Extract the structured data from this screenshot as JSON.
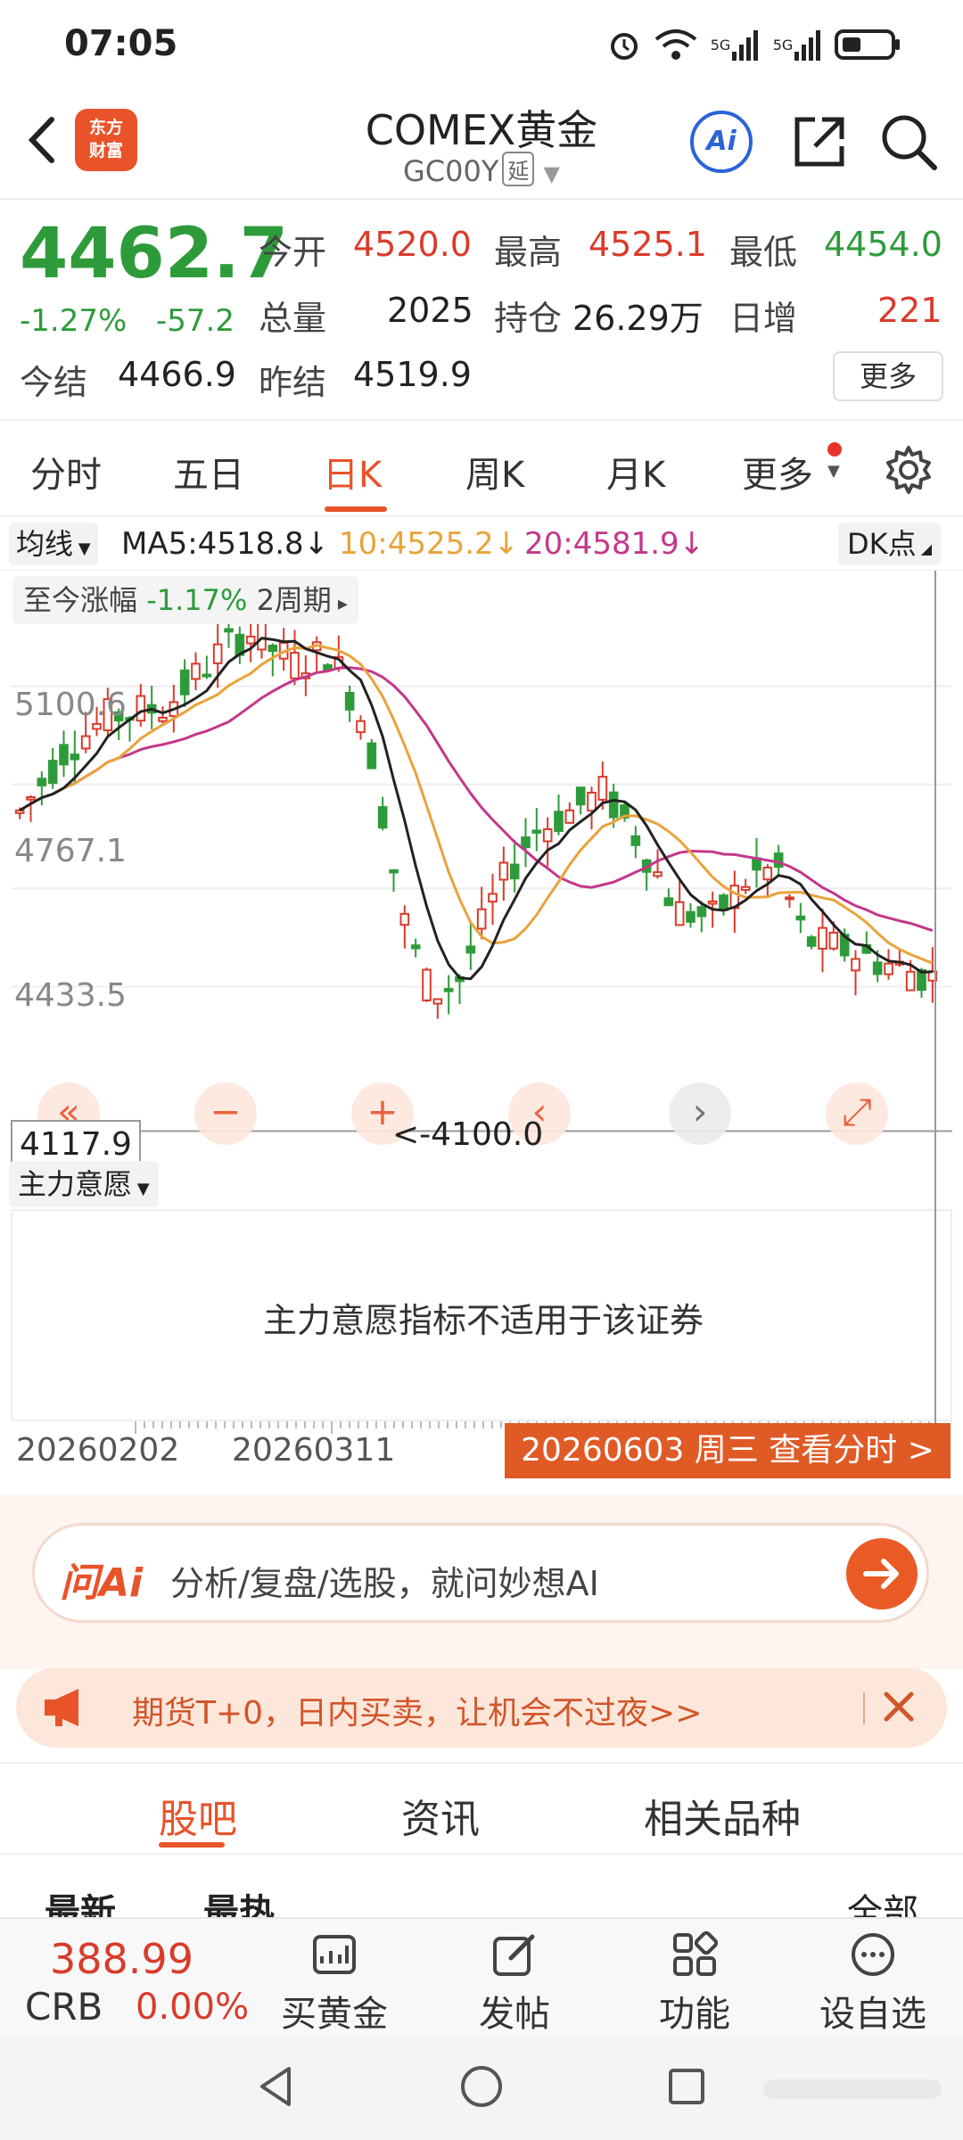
{
  "status_bar": {
    "time": "07:05",
    "network1": "5G",
    "network2": "5G"
  },
  "header": {
    "logo_line1": "东方",
    "logo_line2": "财富",
    "title": "COMEX黄金",
    "subtitle": "GC00Y",
    "delay_tag": "延",
    "ai_label": "Ai"
  },
  "quote": {
    "last": "4462.7",
    "change_pct": "-1.27%",
    "change_abs": "-57.2",
    "open_label": "今开",
    "open": "4520.0",
    "high_label": "最高",
    "high": "4525.1",
    "low_label": "最低",
    "low": "4454.0",
    "volume_label": "总量",
    "volume": "2025",
    "oi_label": "持仓",
    "oi": "26.29万",
    "daily_add_label": "日增",
    "daily_add": "221",
    "settle_label": "今结",
    "settle": "4466.9",
    "prev_settle_label": "昨结",
    "prev_settle": "4519.9",
    "more_label": "更多"
  },
  "period_tabs": [
    "分时",
    "五日",
    "日K",
    "周K",
    "月K",
    "更多"
  ],
  "ma": {
    "select_label": "均线",
    "ma5": "MA5:4518.8↓",
    "ma10": "10:4525.2↓",
    "ma20": "20:4581.9↓",
    "dk_label": "DK点",
    "colors": {
      "ma5": "#222222",
      "ma10": "#e9a33a",
      "ma20": "#c4378a",
      "up": "#d93b2b",
      "down": "#2e9b3a"
    }
  },
  "chart": {
    "period_change_label": "至今涨幅",
    "period_change_value": "-1.17%",
    "period_span": "2周期",
    "y_labels": [
      "5100.6",
      "4767.1",
      "4433.5"
    ],
    "low_label": "4117.9",
    "low_marker": "<-4100.0",
    "controls": [
      "«",
      "−",
      "+",
      "‹",
      "›",
      "⤢"
    ]
  },
  "indicator": {
    "select_label": "主力意愿",
    "message": "主力意愿指标不适用于该证券"
  },
  "dates": {
    "start": "20260202",
    "mid": "20260311",
    "detail_button": "20260603 周三 查看分时 >"
  },
  "ai_bar": {
    "logo": "问Ai",
    "placeholder": "分析/复盘/选股，就问妙想AI"
  },
  "promo": {
    "text": "期货T+0，日内买卖，让机会不过夜>>"
  },
  "content_tabs": [
    "股吧",
    "资讯",
    "相关品种"
  ],
  "sort": {
    "latest": "最新",
    "hottest": "最热",
    "filter": "全部"
  },
  "bottom_bar": {
    "crb_value": "388.99",
    "crb_name": "CRB",
    "crb_change": "0.00%",
    "buy_gold": "买黄金",
    "post": "发帖",
    "functions": "功能",
    "watchlist": "设自选"
  }
}
